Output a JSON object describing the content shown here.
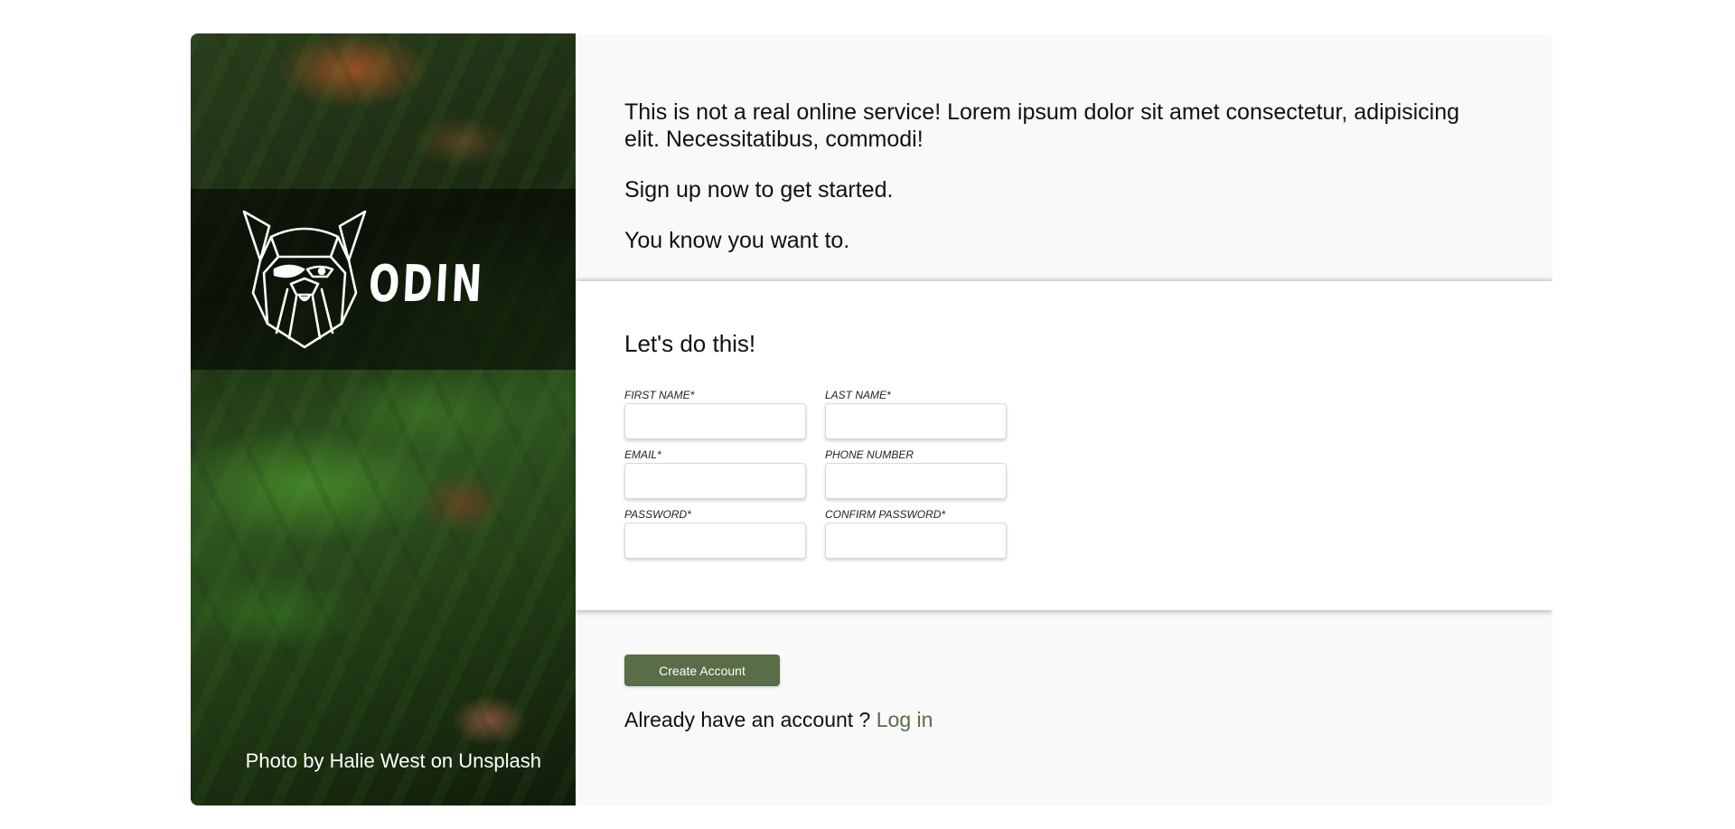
{
  "brand": {
    "name": "ODIN",
    "photo_credit": "Photo by Halie West on Unsplash"
  },
  "intro": {
    "line1": "This is not a real online service! Lorem ipsum dolor sit amet consectetur, adipisicing elit. Necessitatibus, commodi!",
    "line2": "Sign up now to get started.",
    "line3": "You know you want to."
  },
  "form": {
    "heading": "Let's do this!",
    "fields": [
      {
        "label": "FIRST NAME*",
        "value": ""
      },
      {
        "label": "LAST NAME*",
        "value": ""
      },
      {
        "label": "EMAIL*",
        "value": ""
      },
      {
        "label": "PHONE NUMBER",
        "value": ""
      },
      {
        "label": "PASSWORD*",
        "value": ""
      },
      {
        "label": "CONFIRM PASSWORD*",
        "value": ""
      }
    ]
  },
  "footer": {
    "submit_label": "Create Account",
    "login_prompt": "Already have an account ? ",
    "login_link": "Log in"
  },
  "colors": {
    "accent": "#596d48",
    "panel_bg": "#f9f9f9",
    "form_bg": "#ffffff"
  }
}
